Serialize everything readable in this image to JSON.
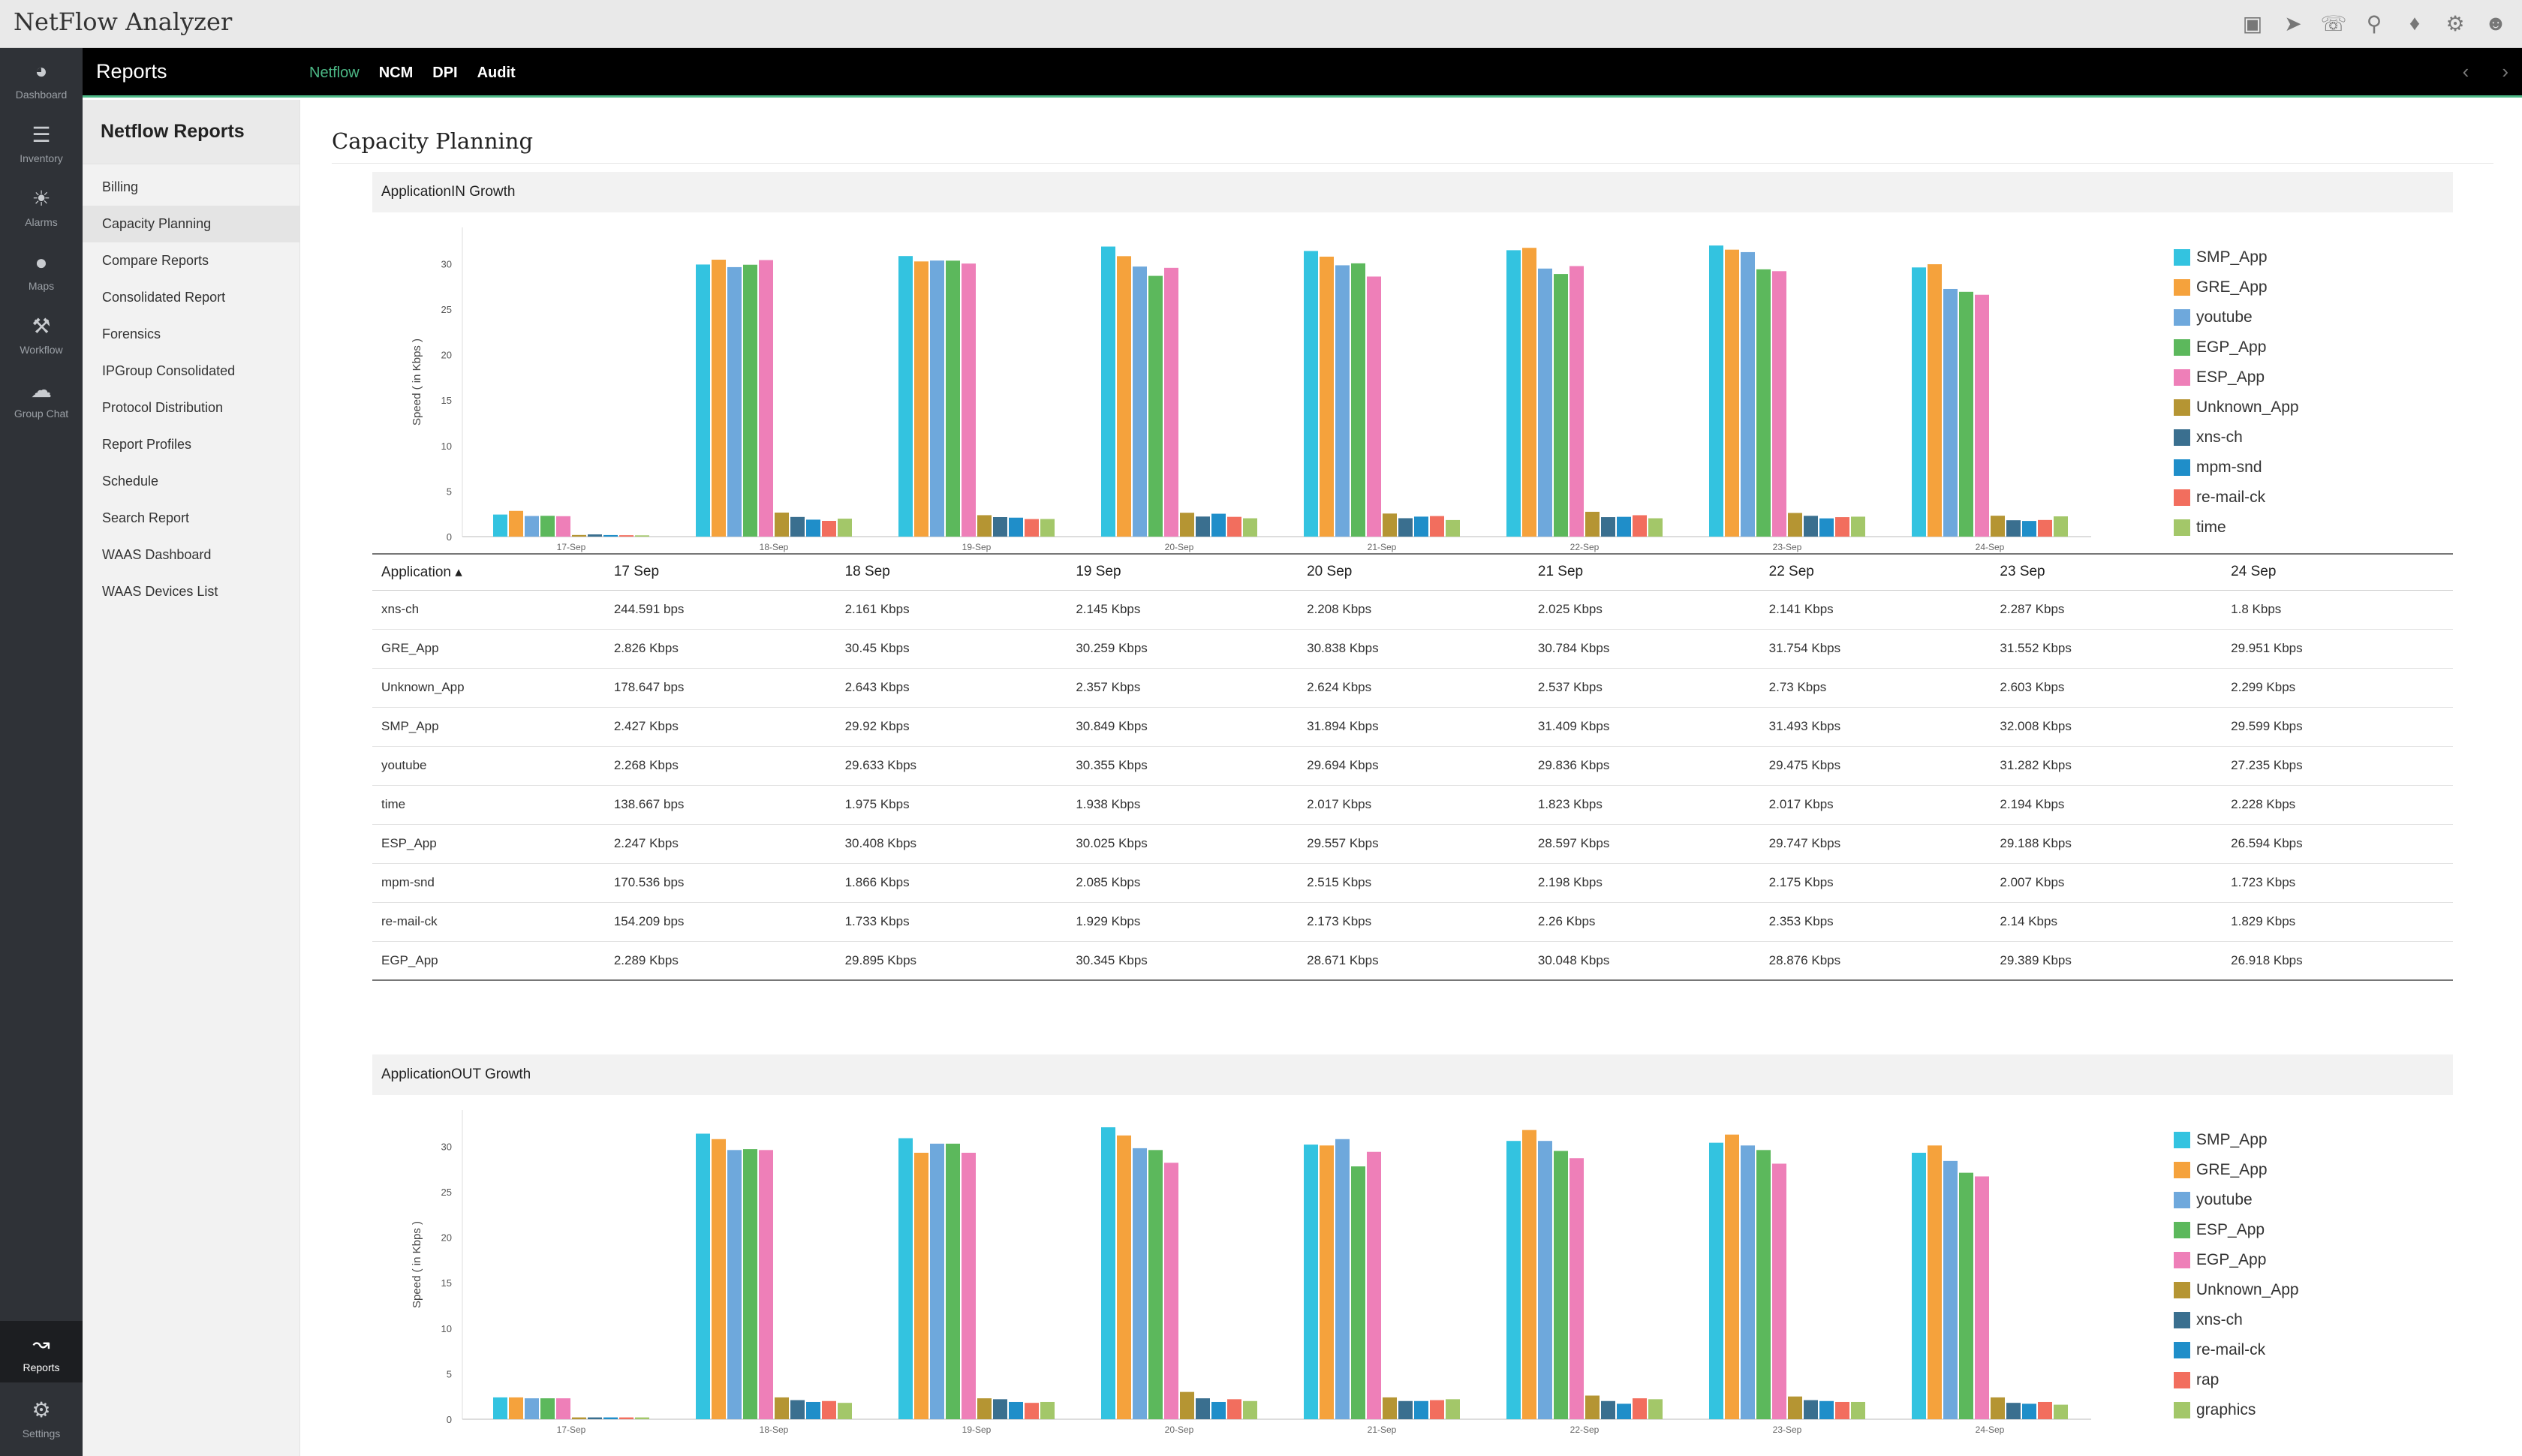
{
  "app": {
    "title": "NetFlow Analyzer"
  },
  "topbar": {
    "icons": [
      "monitor-icon",
      "rocket-icon",
      "headset-icon",
      "search-icon",
      "bell-icon",
      "gear-icon",
      "user-icon"
    ]
  },
  "leftnav": {
    "items": [
      {
        "label": "Dashboard",
        "icon": "dashboard-icon"
      },
      {
        "label": "Inventory",
        "icon": "inventory-icon"
      },
      {
        "label": "Alarms",
        "icon": "alarm-icon"
      },
      {
        "label": "Maps",
        "icon": "map-pin-icon"
      },
      {
        "label": "Workflow",
        "icon": "workflow-icon"
      },
      {
        "label": "Group Chat",
        "icon": "chat-icon"
      }
    ],
    "bottom": [
      {
        "label": "Reports",
        "icon": "reports-icon",
        "active": true
      },
      {
        "label": "Settings",
        "icon": "settings-icon"
      }
    ]
  },
  "module": {
    "title": "Reports",
    "tabs": [
      "Netflow",
      "NCM",
      "DPI",
      "Audit"
    ],
    "active_tab": "Netflow"
  },
  "subnav": {
    "title": "Netflow Reports",
    "items": [
      "Billing",
      "Capacity Planning",
      "Compare Reports",
      "Consolidated Report",
      "Forensics",
      "IPGroup Consolidated",
      "Protocol Distribution",
      "Report Profiles",
      "Schedule",
      "Search Report",
      "WAAS Dashboard",
      "WAAS Devices List"
    ],
    "active": "Capacity Planning"
  },
  "page": {
    "title": "Capacity Planning"
  },
  "chart_data": [
    {
      "type": "bar",
      "title": "ApplicationIN Growth",
      "ylabel": "Speed ( in Kbps )",
      "ylim": [
        0,
        34
      ],
      "yticks": [
        0,
        5,
        10,
        15,
        20,
        25,
        30
      ],
      "categories": [
        "17-Sep",
        "18-Sep",
        "19-Sep",
        "20-Sep",
        "21-Sep",
        "22-Sep",
        "23-Sep",
        "24-Sep"
      ],
      "legend_position": "right",
      "series": [
        {
          "name": "SMP_App",
          "color": "#33c3e0",
          "values": [
            2.427,
            29.92,
            30.849,
            31.894,
            31.409,
            31.493,
            32.008,
            29.599
          ]
        },
        {
          "name": "GRE_App",
          "color": "#f5a23c",
          "values": [
            2.826,
            30.45,
            30.259,
            30.838,
            30.784,
            31.754,
            31.552,
            29.951
          ]
        },
        {
          "name": "youtube",
          "color": "#6ea8dc",
          "values": [
            2.268,
            29.633,
            30.355,
            29.694,
            29.836,
            29.475,
            31.282,
            27.235
          ]
        },
        {
          "name": "EGP_App",
          "color": "#5cb85c",
          "values": [
            2.289,
            29.895,
            30.345,
            28.671,
            30.048,
            28.876,
            29.389,
            26.918
          ]
        },
        {
          "name": "ESP_App",
          "color": "#ee7fb8",
          "values": [
            2.247,
            30.408,
            30.025,
            29.557,
            28.597,
            29.747,
            29.188,
            26.594
          ]
        },
        {
          "name": "Unknown_App",
          "color": "#b59533",
          "values": [
            0.179,
            2.643,
            2.357,
            2.624,
            2.537,
            2.73,
            2.603,
            2.299
          ]
        },
        {
          "name": "xns-ch",
          "color": "#3a6f8f",
          "values": [
            0.245,
            2.161,
            2.145,
            2.208,
            2.025,
            2.141,
            2.287,
            1.8
          ]
        },
        {
          "name": "mpm-snd",
          "color": "#1f8ec9",
          "values": [
            0.171,
            1.866,
            2.085,
            2.515,
            2.198,
            2.175,
            2.007,
            1.723
          ]
        },
        {
          "name": "re-mail-ck",
          "color": "#f26e5e",
          "values": [
            0.154,
            1.733,
            1.929,
            2.173,
            2.26,
            2.353,
            2.14,
            1.829
          ]
        },
        {
          "name": "time",
          "color": "#a3c769",
          "values": [
            0.139,
            1.975,
            1.938,
            2.017,
            1.823,
            2.017,
            2.194,
            2.228
          ]
        }
      ]
    },
    {
      "type": "bar",
      "title": "ApplicationOUT Growth",
      "ylabel": "Speed ( in Kbps )",
      "ylim": [
        0,
        34
      ],
      "yticks": [
        0,
        5,
        10,
        15,
        20,
        25,
        30
      ],
      "categories": [
        "17-Sep",
        "18-Sep",
        "19-Sep",
        "20-Sep",
        "21-Sep",
        "22-Sep",
        "23-Sep",
        "24-Sep"
      ],
      "legend_position": "right",
      "series": [
        {
          "name": "SMP_App",
          "color": "#33c3e0",
          "values": [
            2.4,
            31.4,
            30.9,
            32.1,
            30.2,
            30.6,
            30.4,
            29.3
          ]
        },
        {
          "name": "GRE_App",
          "color": "#f5a23c",
          "values": [
            2.4,
            30.8,
            29.3,
            31.2,
            30.1,
            31.8,
            31.3,
            30.1
          ]
        },
        {
          "name": "youtube",
          "color": "#6ea8dc",
          "values": [
            2.3,
            29.6,
            30.3,
            29.8,
            30.8,
            30.6,
            30.1,
            28.4
          ]
        },
        {
          "name": "ESP_App",
          "color": "#5cb85c",
          "values": [
            2.3,
            29.7,
            30.3,
            29.6,
            27.8,
            29.5,
            29.6,
            27.1
          ]
        },
        {
          "name": "EGP_App",
          "color": "#ee7fb8",
          "values": [
            2.3,
            29.6,
            29.3,
            28.2,
            29.4,
            28.7,
            28.1,
            26.7
          ]
        },
        {
          "name": "Unknown_App",
          "color": "#b59533",
          "values": [
            0.2,
            2.4,
            2.3,
            3.0,
            2.4,
            2.6,
            2.5,
            2.4
          ]
        },
        {
          "name": "xns-ch",
          "color": "#3a6f8f",
          "values": [
            0.2,
            2.1,
            2.2,
            2.3,
            2.0,
            2.0,
            2.1,
            1.8
          ]
        },
        {
          "name": "re-mail-ck",
          "color": "#1f8ec9",
          "values": [
            0.2,
            1.9,
            1.9,
            1.9,
            2.0,
            1.7,
            2.0,
            1.7
          ]
        },
        {
          "name": "rap",
          "color": "#f26e5e",
          "values": [
            0.2,
            2.0,
            1.8,
            2.2,
            2.1,
            2.3,
            1.9,
            1.9
          ]
        },
        {
          "name": "graphics",
          "color": "#a3c769",
          "values": [
            0.2,
            1.8,
            1.9,
            2.0,
            2.2,
            2.2,
            1.9,
            1.6
          ]
        }
      ]
    }
  ],
  "table": {
    "headers": [
      "Application",
      "17 Sep",
      "18 Sep",
      "19 Sep",
      "20 Sep",
      "21 Sep",
      "22 Sep",
      "23 Sep",
      "24 Sep"
    ],
    "rows": [
      [
        "xns-ch",
        "244.591 bps",
        "2.161 Kbps",
        "2.145 Kbps",
        "2.208 Kbps",
        "2.025 Kbps",
        "2.141 Kbps",
        "2.287 Kbps",
        "1.8 Kbps"
      ],
      [
        "GRE_App",
        "2.826 Kbps",
        "30.45 Kbps",
        "30.259 Kbps",
        "30.838 Kbps",
        "30.784 Kbps",
        "31.754 Kbps",
        "31.552 Kbps",
        "29.951 Kbps"
      ],
      [
        "Unknown_App",
        "178.647 bps",
        "2.643 Kbps",
        "2.357 Kbps",
        "2.624 Kbps",
        "2.537 Kbps",
        "2.73 Kbps",
        "2.603 Kbps",
        "2.299 Kbps"
      ],
      [
        "SMP_App",
        "2.427 Kbps",
        "29.92 Kbps",
        "30.849 Kbps",
        "31.894 Kbps",
        "31.409 Kbps",
        "31.493 Kbps",
        "32.008 Kbps",
        "29.599 Kbps"
      ],
      [
        "youtube",
        "2.268 Kbps",
        "29.633 Kbps",
        "30.355 Kbps",
        "29.694 Kbps",
        "29.836 Kbps",
        "29.475 Kbps",
        "31.282 Kbps",
        "27.235 Kbps"
      ],
      [
        "time",
        "138.667 bps",
        "1.975 Kbps",
        "1.938 Kbps",
        "2.017 Kbps",
        "1.823 Kbps",
        "2.017 Kbps",
        "2.194 Kbps",
        "2.228 Kbps"
      ],
      [
        "ESP_App",
        "2.247 Kbps",
        "30.408 Kbps",
        "30.025 Kbps",
        "29.557 Kbps",
        "28.597 Kbps",
        "29.747 Kbps",
        "29.188 Kbps",
        "26.594 Kbps"
      ],
      [
        "mpm-snd",
        "170.536 bps",
        "1.866 Kbps",
        "2.085 Kbps",
        "2.515 Kbps",
        "2.198 Kbps",
        "2.175 Kbps",
        "2.007 Kbps",
        "1.723 Kbps"
      ],
      [
        "re-mail-ck",
        "154.209 bps",
        "1.733 Kbps",
        "1.929 Kbps",
        "2.173 Kbps",
        "2.26 Kbps",
        "2.353 Kbps",
        "2.14 Kbps",
        "1.829 Kbps"
      ],
      [
        "EGP_App",
        "2.289 Kbps",
        "29.895 Kbps",
        "30.345 Kbps",
        "28.671 Kbps",
        "30.048 Kbps",
        "28.876 Kbps",
        "29.389 Kbps",
        "26.918 Kbps"
      ]
    ]
  }
}
